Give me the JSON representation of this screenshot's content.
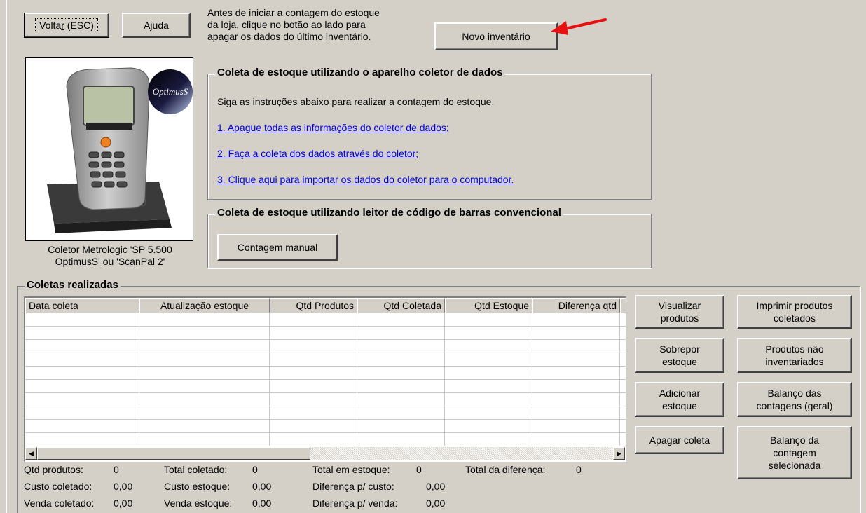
{
  "toolbar": {
    "back_label_pre": "Volta",
    "back_label_u": "r",
    "back_label_post": " (ESC)",
    "help_label": "Ajuda"
  },
  "intro": {
    "line1": "Antes de iniciar a contagem do estoque",
    "line2": "da loja, clique no botão ao lado para",
    "line3": "apagar os dados do último inventário.",
    "new_inventory_label": "Novo inventário"
  },
  "device": {
    "brand_logo": "OptimusS",
    "caption_line1": "Coletor Metrologic 'SP 5.500",
    "caption_line2": "OptimusS' ou 'ScanPal 2'"
  },
  "collector_group": {
    "title": "Coleta de estoque utilizando o aparelho coletor de dados",
    "instruction": "Siga as instruções abaixo para realizar a contagem do estoque.",
    "link1": "1. Apague todas as informações do coletor de dados;",
    "link2": "2. Faça a coleta dos dados através do coletor;",
    "link3": "3. Clique aqui para importar os dados do coletor para o computador."
  },
  "barcode_group": {
    "title": "Coleta de estoque utilizando leitor de código de barras convencional",
    "manual_count_label": "Contagem manual"
  },
  "collections": {
    "title": "Coletas realizadas",
    "columns": [
      "Data coleta",
      "Atualização estoque",
      "Qtd Produtos",
      "Qtd Coletada",
      "Qtd Estoque",
      "Diferença qtd",
      ""
    ],
    "rows": []
  },
  "actions": {
    "view_products": "Visualizar produtos",
    "print_collected": "Imprimir produtos coletados",
    "overwrite_stock": "Sobrepor estoque",
    "not_inventoried": "Produtos não inventariados",
    "add_stock": "Adicionar estoque",
    "balance_general": "Balanço das contagens (geral)",
    "delete_collection": "Apagar coleta",
    "balance_selected": "Balanço da contagem selecionada"
  },
  "totals": {
    "qtd_produtos_label": "Qtd produtos:",
    "qtd_produtos_value": "0",
    "total_coletado_label": "Total coletado:",
    "total_coletado_value": "0",
    "total_estoque_label": "Total em estoque:",
    "total_estoque_value": "0",
    "total_diferenca_label": "Total da diferença:",
    "total_diferenca_value": "0",
    "custo_coletado_label": "Custo coletado:",
    "custo_coletado_value": "0,00",
    "custo_estoque_label": "Custo estoque:",
    "custo_estoque_value": "0,00",
    "diferenca_custo_label": "Diferença p/ custo:",
    "diferenca_custo_value": "0,00",
    "venda_coletado_label": "Venda coletado:",
    "venda_coletado_value": "0,00",
    "venda_estoque_label": "Venda estoque:",
    "venda_estoque_value": "0,00",
    "diferenca_venda_label": "Diferença p/ venda:",
    "diferenca_venda_value": "0,00"
  },
  "colors": {
    "window_bg": "#d4d0c8",
    "link": "#0000ee",
    "annotation_arrow": "#e81010"
  }
}
